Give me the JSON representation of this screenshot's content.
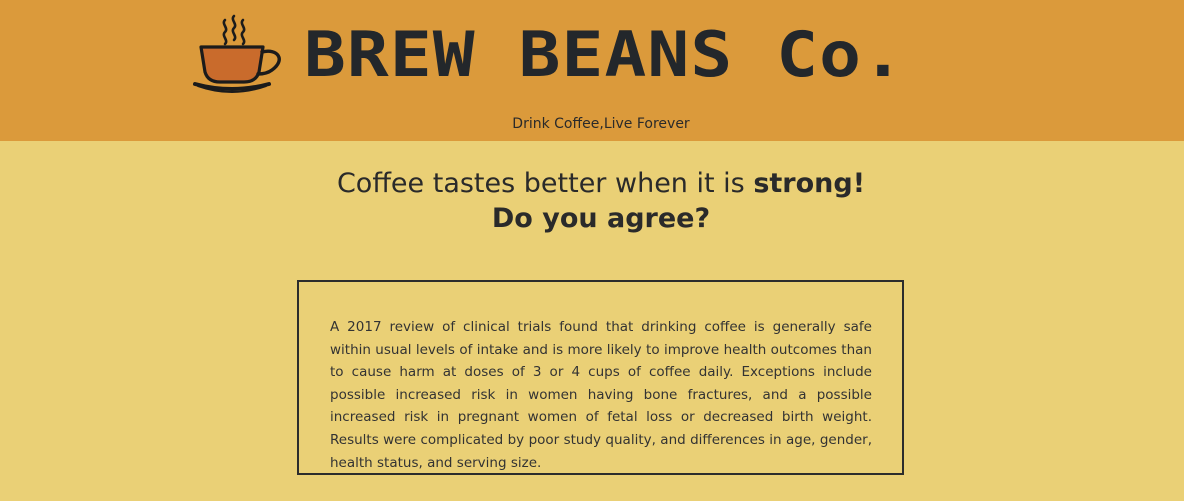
{
  "header": {
    "brand": "BREW BEANS Co.",
    "tagline": "Drink Coffee,Live Forever",
    "logo_icon": "coffee-cup-icon",
    "background_color": "#db9a3b"
  },
  "main": {
    "headline_part1": "Coffee tastes better when it is ",
    "headline_bold": "strong!",
    "headline_line2": "Do you agree?",
    "background_color": "#ead076",
    "info_text": "A 2017 review of clinical trials found that drinking coffee is generally safe within usual levels of intake and is more likely to improve health outcomes than to cause harm at doses of 3 or 4 cups of coffee daily. Exceptions include possible increased risk in women having bone fractures, and a possible increased risk in pregnant women of fetal loss or decreased birth weight. Results were complicated by poor study quality, and differences in age, gender, health status, and serving size."
  }
}
